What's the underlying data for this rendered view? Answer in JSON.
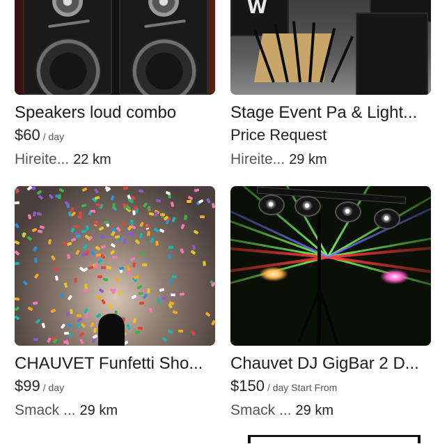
{
  "listings": [
    {
      "title": "Speakers loud combo",
      "price": "$60",
      "price_unit": "/ day",
      "owner": "Hireite...",
      "distance": "22 km"
    },
    {
      "title": "Stage Event Pa & Light...",
      "price": "Price Request",
      "price_unit": "",
      "owner": "Hireite...",
      "distance": "29 km"
    },
    {
      "title": "CHAUVET Funfetti Sho...",
      "price": "$99",
      "price_unit": "/ day",
      "owner": "Smack ...",
      "distance": "29 km"
    },
    {
      "title": "Chauvet DJ GigBar 2 D...",
      "price": "$150",
      "price_unit": "/ day Start From",
      "owner": "Smack ...",
      "distance": "29 km"
    }
  ],
  "colors": {
    "text_primary": "#1c1c1c",
    "text_secondary": "#555555",
    "background": "#ffffff"
  }
}
